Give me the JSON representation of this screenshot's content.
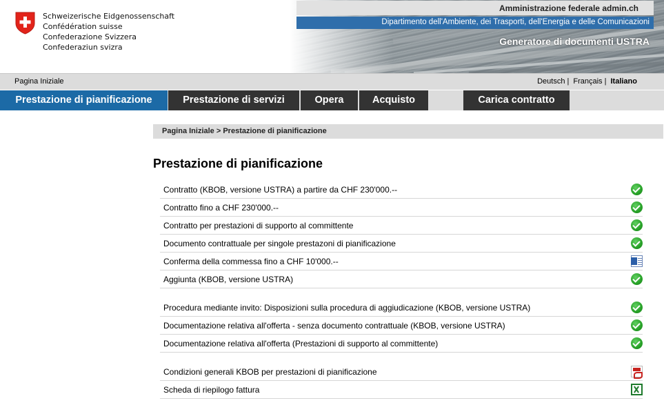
{
  "header": {
    "confederation_names": [
      "Schweizerische Eidgenossenschaft",
      "Confédération suisse",
      "Confederazione Svizzera",
      "Confederaziun svizra"
    ],
    "admin_label": "Amministrazione federale admin.ch",
    "department": "Dipartimento dell'Ambiente, dei Trasporti, dell'Energia e delle Comunicazioni",
    "app_title": "Generatore di documenti USTRA"
  },
  "service": {
    "home": "Pagina Iniziale",
    "languages": [
      {
        "label": "Deutsch",
        "active": false
      },
      {
        "label": "Français",
        "active": false
      },
      {
        "label": "Italiano",
        "active": true
      }
    ]
  },
  "nav": [
    {
      "label": "Prestazione di pianificazione",
      "active": true
    },
    {
      "label": "Prestazione di servizi",
      "active": false
    },
    {
      "label": "Opera",
      "active": false
    },
    {
      "label": "Acquisto",
      "active": false
    },
    {
      "label": "Carica contratto",
      "active": false
    }
  ],
  "breadcrumb": "Pagina Iniziale > Prestazione di pianificazione",
  "page_title": "Prestazione di pianificazione",
  "groups": [
    {
      "items": [
        {
          "label": "Contratto (KBOB, versione USTRA) a partire da CHF 230'000.--",
          "icon": "check-icon"
        },
        {
          "label": "Contratto fino a CHF 230'000.--",
          "icon": "check-icon"
        },
        {
          "label": "Contratto per prestazioni di supporto al committente",
          "icon": "check-icon"
        },
        {
          "label": "Documento contrattuale per singole prestazoni di pianificazione",
          "icon": "check-icon"
        },
        {
          "label": "Conferma della commessa fino a CHF 10'000.--",
          "icon": "word-document-icon"
        },
        {
          "label": "Aggiunta (KBOB, versione USTRA)",
          "icon": "check-icon"
        }
      ]
    },
    {
      "items": [
        {
          "label": "Procedura mediante invito: Disposizioni sulla procedura di aggiudicazione (KBOB, versione USTRA)",
          "icon": "check-icon"
        },
        {
          "label": "Documentazione relativa all'offerta - senza documento contrattuale (KBOB, versione USTRA)",
          "icon": "check-icon"
        },
        {
          "label": "Documentazione relativa all'offerta (Prestazioni di supporto al committente)",
          "icon": "check-icon"
        }
      ]
    },
    {
      "items": [
        {
          "label": "Condizioni generali KBOB per prestazioni di pianificazione",
          "icon": "pdf-document-icon"
        },
        {
          "label": "Scheda di riepilogo fattura",
          "icon": "excel-document-icon"
        }
      ]
    }
  ],
  "colors": {
    "active_tab": "#1c6aa6",
    "tab": "#333333",
    "department_bar": "#2f6eab",
    "check_green": "#27a127"
  }
}
